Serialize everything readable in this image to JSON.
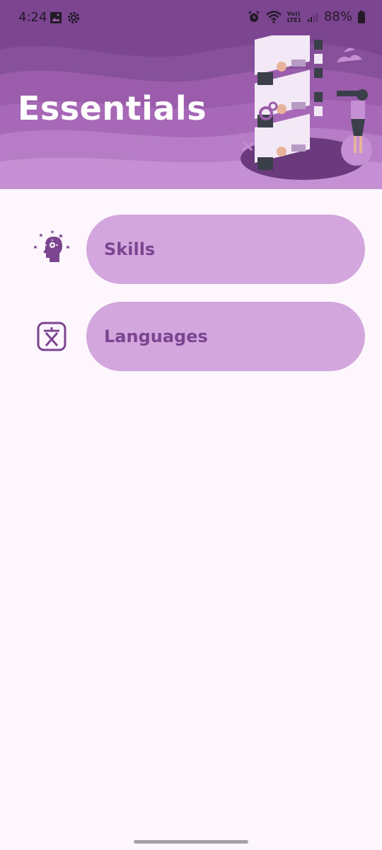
{
  "status_bar": {
    "time": "4:24",
    "battery": "88%",
    "left_icons": [
      "image-icon",
      "settings-gear-icon"
    ],
    "right_icons": [
      "alarm-icon",
      "wifi-icon",
      "volte-icon",
      "signal-icon",
      "battery-icon"
    ],
    "volte_text_top": "Vo))",
    "volte_text_bottom": "LTE1"
  },
  "header": {
    "title": "Essentials",
    "colors": {
      "dark": "#7b4590",
      "mid": "#9a5cab",
      "light": "#c590d3"
    }
  },
  "menu": {
    "items": [
      {
        "label": "Skills",
        "icon": "head-stars-icon"
      },
      {
        "label": "Languages",
        "icon": "translate-icon"
      }
    ],
    "pill_color": "#d3a7de",
    "text_color": "#7b4590"
  }
}
